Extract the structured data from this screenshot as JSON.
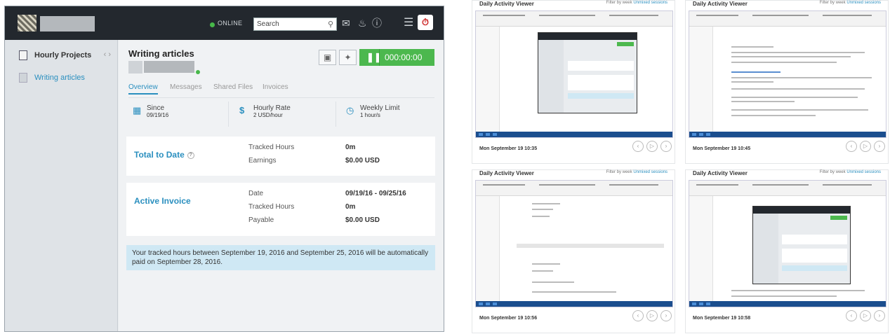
{
  "app": {
    "topbar": {
      "status_label": "ONLINE",
      "search_placeholder": "Search"
    },
    "sidebar": {
      "items": [
        {
          "label": "Hourly Projects"
        },
        {
          "label": "Writing articles"
        }
      ]
    },
    "job": {
      "title": "Writing articles",
      "timer": "000:00:00",
      "tabs": [
        "Overview",
        "Messages",
        "Shared Files",
        "Invoices"
      ],
      "stats": [
        {
          "label": "Since",
          "value": "09/19/16",
          "icon": "calendar-icon"
        },
        {
          "label": "Hourly Rate",
          "value": "2 USD/hour",
          "icon": "dollar-icon"
        },
        {
          "label": "Weekly Limit",
          "value": "1 hour/s",
          "icon": "clock-icon"
        }
      ],
      "total_to_date": {
        "title": "Total to Date",
        "rows": [
          {
            "label": "Tracked Hours",
            "value": "0m"
          },
          {
            "label": "Earnings",
            "value": "$0.00 USD"
          }
        ]
      },
      "active_invoice": {
        "title": "Active Invoice",
        "rows": [
          {
            "label": "Date",
            "value": "09/19/16 - 09/25/16"
          },
          {
            "label": "Tracked Hours",
            "value": "0m"
          },
          {
            "label": "Payable",
            "value": "$0.00 USD"
          }
        ]
      },
      "notice": "Your tracked hours between September 19, 2016 and September 25, 2016 will be automatically paid on September 28, 2016."
    }
  },
  "viewer": {
    "title": "Daily Activity Viewer",
    "filter_label": "Filter by week",
    "filter_link": "Unmixed sessions",
    "thumbnails": [
      {
        "time": "Mon September 19 10:35"
      },
      {
        "time": "Mon September 19 10:45"
      },
      {
        "time": "Mon September 19 10:56"
      },
      {
        "time": "Mon September 19 10:58"
      }
    ]
  },
  "colors": {
    "topbar": "#23282e",
    "accent_blue": "#2a8fbf",
    "timer_green": "#4cb84e",
    "notice_bg": "#cfe8f4"
  }
}
